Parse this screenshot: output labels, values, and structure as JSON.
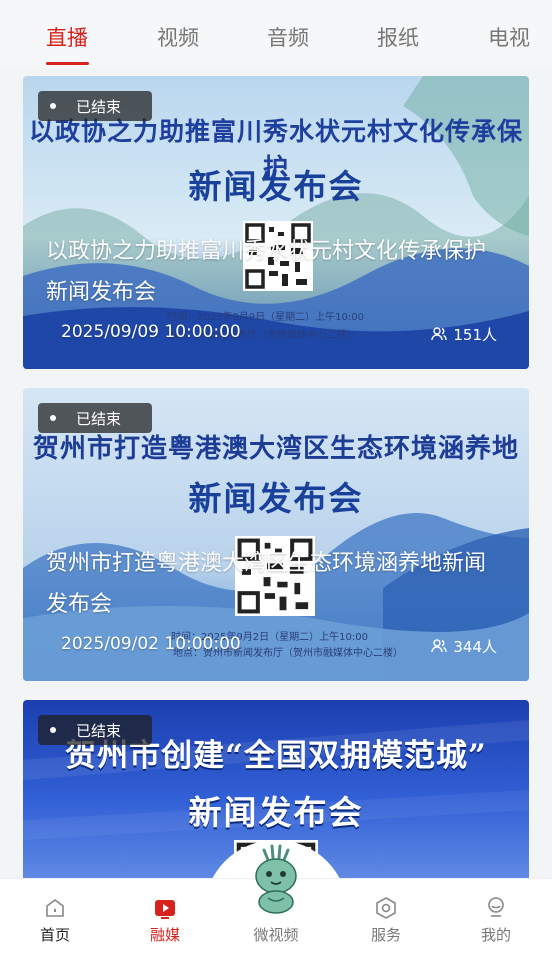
{
  "tabs": [
    "直播",
    "视频",
    "音频",
    "报纸",
    "电视"
  ],
  "active_tab": 0,
  "cards": [
    {
      "status": "已结束",
      "poster_headline": "以政协之力助推富川秀水状元村文化传承保护",
      "poster_subhead": "新闻发布会",
      "poster_time": "时间：2025年9月9日（星期二）上午10:00",
      "poster_place": "地点：市新闻发布厅（市融媒体中心二楼）",
      "title": "以政协之力助推富川秀水状元村文化传承保护新闻发布会",
      "datetime": "2025/09/09 10:00:00",
      "viewers": "151人"
    },
    {
      "status": "已结束",
      "poster_headline": "贺州市打造粤港澳大湾区生态环境涵养地",
      "poster_subhead": "新闻发布会",
      "poster_time": "时间：2025年9月2日（星期二）上午10:00",
      "poster_place": "地点：贺州市新闻发布厅（贺州市融媒体中心二楼）",
      "title": "贺州市打造粤港澳大湾区生态环境涵养地新闻发布会",
      "datetime": "2025/09/02 10:00:00",
      "viewers": "344人"
    },
    {
      "status": "已结束",
      "poster_headline": "贺州市创建“全国双拥模范城”",
      "poster_subhead": "新闻发布会"
    }
  ],
  "nav": [
    {
      "label": "首页",
      "icon": "home-icon"
    },
    {
      "label": "融媒",
      "icon": "play-icon"
    },
    {
      "label": "微视频",
      "icon": "mascot-icon"
    },
    {
      "label": "服务",
      "icon": "service-icon"
    },
    {
      "label": "我的",
      "icon": "profile-icon"
    }
  ],
  "active_nav": 1,
  "colors": {
    "accent": "#d7231d",
    "inactive": "#777777"
  }
}
